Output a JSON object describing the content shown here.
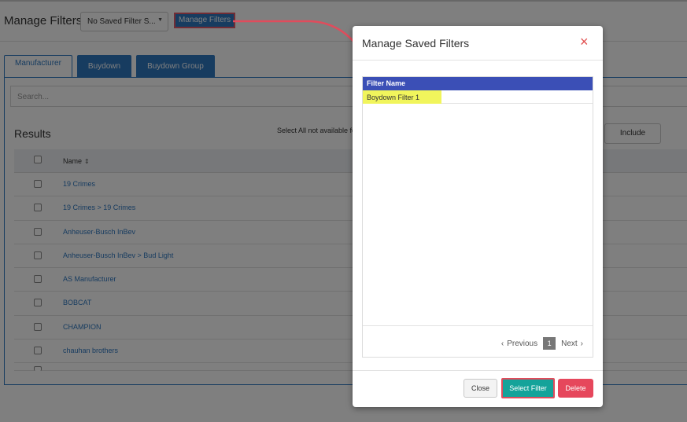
{
  "header": {
    "title": "Manage Filters",
    "saved_filter_select": "No Saved Filter S...",
    "manage_button": "Manage Filters"
  },
  "tabs": [
    {
      "label": "Manufacturer"
    },
    {
      "label": "Buydown"
    },
    {
      "label": "Buydown Group"
    }
  ],
  "search": {
    "placeholder": "Search..."
  },
  "results": {
    "title": "Results",
    "select_all_note": "Select All not available fo",
    "include_button": "Include",
    "name_column": "Name",
    "rows": [
      "19 Crimes",
      "19 Crimes > 19 Crimes",
      "Anheuser-Busch InBev",
      "Anheuser-Busch InBev > Bud Light",
      "AS Manufacturer",
      "BOBCAT",
      "CHAMPION",
      "chauhan brothers"
    ]
  },
  "modal": {
    "title": "Manage Saved Filters",
    "close_icon": "×",
    "grid_header": "Filter Name",
    "rows": [
      "Boydown Filter 1"
    ],
    "pager": {
      "previous": "Previous",
      "page": "1",
      "next": "Next"
    },
    "buttons": {
      "close": "Close",
      "select": "Select Filter",
      "delete": "Delete"
    }
  },
  "colors": {
    "primary": "#2f78c0",
    "grid_header": "#3b4fb6",
    "highlight": "#f1f55c",
    "select_button": "#14a39a",
    "delete_button": "#e6475c",
    "annotation": "#e04c5c"
  }
}
